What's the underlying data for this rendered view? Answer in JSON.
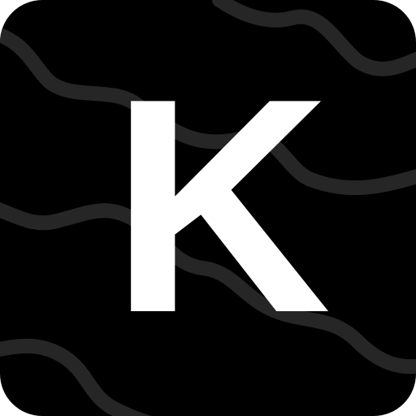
{
  "icon": {
    "letter": "K",
    "background_color": "#000000",
    "letter_color": "#ffffff",
    "wave_color": "#262626"
  }
}
